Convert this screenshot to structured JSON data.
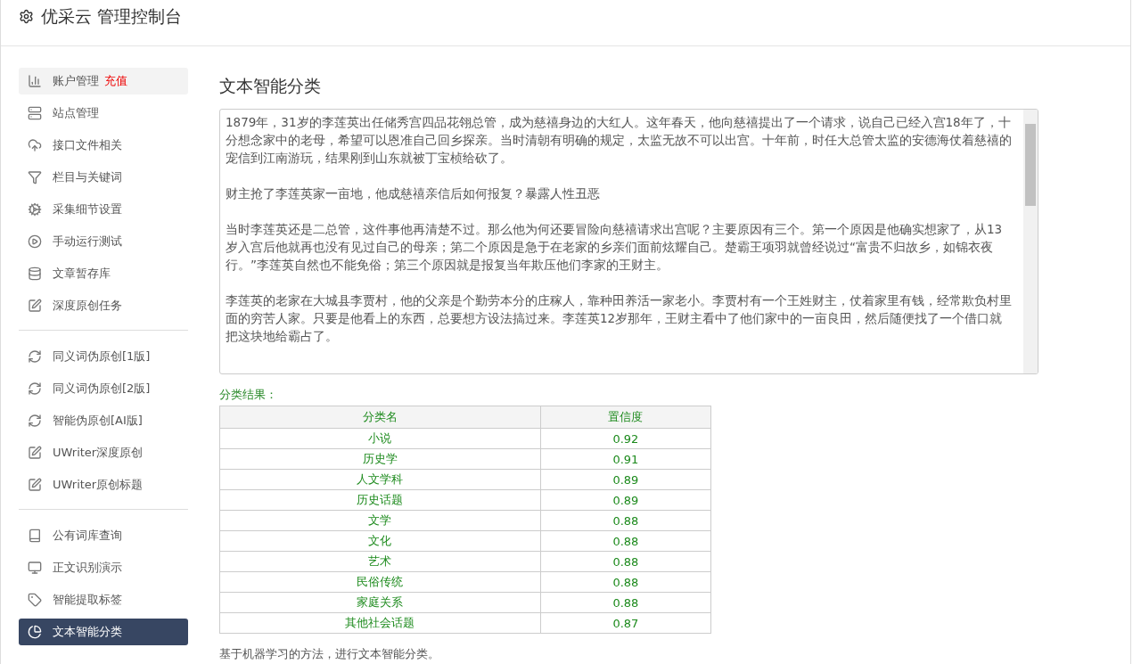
{
  "header": {
    "title": "优采云 管理控制台"
  },
  "sidebar": {
    "groups": [
      {
        "items": [
          {
            "label": "账户管理",
            "badge": "充值",
            "selected": false,
            "hovered": true
          },
          {
            "label": "站点管理",
            "selected": false,
            "hovered": false
          },
          {
            "label": "接口文件相关",
            "selected": false,
            "hovered": false
          },
          {
            "label": "栏目与关键词",
            "selected": false,
            "hovered": false
          },
          {
            "label": "采集细节设置",
            "selected": false,
            "hovered": false
          },
          {
            "label": "手动运行测试",
            "selected": false,
            "hovered": false
          },
          {
            "label": "文章暂存库",
            "selected": false,
            "hovered": false
          },
          {
            "label": "深度原创任务",
            "selected": false,
            "hovered": false
          }
        ]
      },
      {
        "items": [
          {
            "label": "同义词伪原创[1版]",
            "selected": false,
            "hovered": false
          },
          {
            "label": "同义词伪原创[2版]",
            "selected": false,
            "hovered": false
          },
          {
            "label": "智能伪原创[AI版]",
            "selected": false,
            "hovered": false
          },
          {
            "label": "UWriter深度原创",
            "selected": false,
            "hovered": false
          },
          {
            "label": "UWriter原创标题",
            "selected": false,
            "hovered": false
          }
        ]
      },
      {
        "items": [
          {
            "label": "公有词库查询",
            "selected": false,
            "hovered": false
          },
          {
            "label": "正文识别演示",
            "selected": false,
            "hovered": false
          },
          {
            "label": "智能提取标签",
            "selected": false,
            "hovered": false
          },
          {
            "label": "文本智能分类",
            "selected": true,
            "hovered": false
          }
        ]
      }
    ]
  },
  "main": {
    "title": "文本智能分类",
    "article": [
      "1879年，31岁的李莲英出任储秀宫四品花翎总管，成为慈禧身边的大红人。这年春天，他向慈禧提出了一个请求，说自己已经入宫18年了，十分想念家中的老母，希望可以恩准自己回乡探亲。当时清朝有明确的规定，太监无故不可以出宫。十年前，时任大总管太监的安德海仗着慈禧的宠信到江南游玩，结果刚到山东就被丁宝桢给砍了。",
      "财主抢了李莲英家一亩地，他成慈禧亲信后如何报复？暴露人性丑恶",
      "当时李莲英还是二总管，这件事他再清楚不过。那么他为何还要冒险向慈禧请求出宫呢？主要原因有三个。第一个原因是他确实想家了，从13岁入宫后他就再也没有见过自己的母亲；第二个原因是急于在老家的乡亲们面前炫耀自己。楚霸王项羽就曾经说过“富贵不归故乡，如锦衣夜行。”李莲英自然也不能免俗；第三个原因就是报复当年欺压他们李家的王财主。",
      "李莲英的老家在大城县李贾村，他的父亲是个勤劳本分的庄稼人，靠种田养活一家老小。李贾村有一个王姓财主，仗着家里有钱，经常欺负村里面的穷苦人家。只要是他看上的东西，总要想方设法搞过来。李莲英12岁那年，王财主看中了他们家中的一亩良田，然后随便找了一个借口就把这块地给霸占了。"
    ],
    "result_label": "分类结果：",
    "table": {
      "columns": [
        "分类名",
        "置信度"
      ],
      "rows": [
        [
          "小说",
          "0.92"
        ],
        [
          "历史学",
          "0.91"
        ],
        [
          "人文学科",
          "0.89"
        ],
        [
          "历史话题",
          "0.89"
        ],
        [
          "文学",
          "0.88"
        ],
        [
          "文化",
          "0.88"
        ],
        [
          "艺术",
          "0.88"
        ],
        [
          "民俗传统",
          "0.88"
        ],
        [
          "家庭关系",
          "0.88"
        ],
        [
          "其他社会话题",
          "0.87"
        ]
      ]
    },
    "footnote": "基于机器学习的方法，进行文本智能分类。"
  }
}
